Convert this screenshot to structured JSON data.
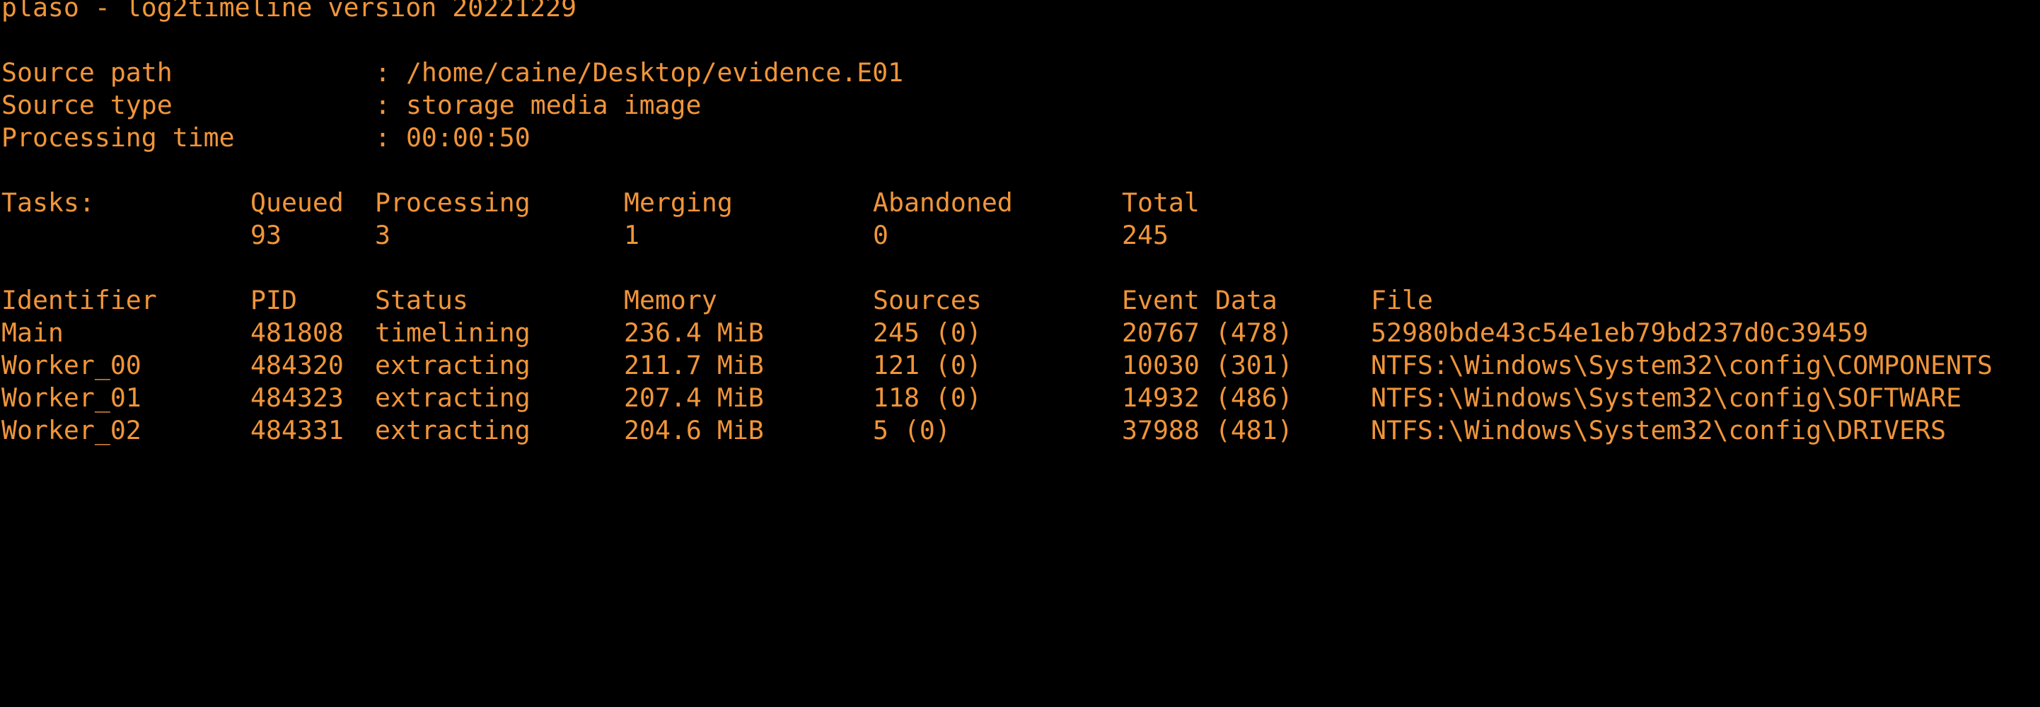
{
  "app": {
    "title": "plaso - log2timeline version 20221229"
  },
  "source": {
    "path_label": "Source path",
    "path_value": ": /home/caine/Desktop/evidence.E01",
    "type_label": "Source type",
    "type_value": ": storage media image",
    "time_label": "Processing time",
    "time_value": ": 00:00:50"
  },
  "tasks": {
    "label": "Tasks:",
    "headers": [
      "Queued",
      "Processing",
      "Merging",
      "Abandoned",
      "Total"
    ],
    "values": [
      "93",
      "3",
      "1",
      "0",
      "245"
    ]
  },
  "workers": {
    "headers": [
      "Identifier",
      "PID",
      "Status",
      "Memory",
      "Sources",
      "Event Data",
      "File"
    ],
    "rows": [
      [
        "Main",
        "481808",
        "timelining",
        "236.4 MiB",
        "245 (0)",
        "20767 (478)",
        "52980bde43c54e1eb79bd237d0c39459"
      ],
      [
        "Worker_00",
        "484320",
        "extracting",
        "211.7 MiB",
        "121 (0)",
        "10030 (301)",
        "NTFS:\\Windows\\System32\\config\\COMPONENTS"
      ],
      [
        "Worker_01",
        "484323",
        "extracting",
        "207.4 MiB",
        "118 (0)",
        "14932 (486)",
        "NTFS:\\Windows\\System32\\config\\SOFTWARE"
      ],
      [
        "Worker_02",
        "484331",
        "extracting",
        "204.6 MiB",
        "5 (0)",
        "37988 (481)",
        "NTFS:\\Windows\\System32\\config\\DRIVERS"
      ]
    ]
  },
  "theme": {
    "background": "#000000",
    "foreground": "#f0953a"
  }
}
